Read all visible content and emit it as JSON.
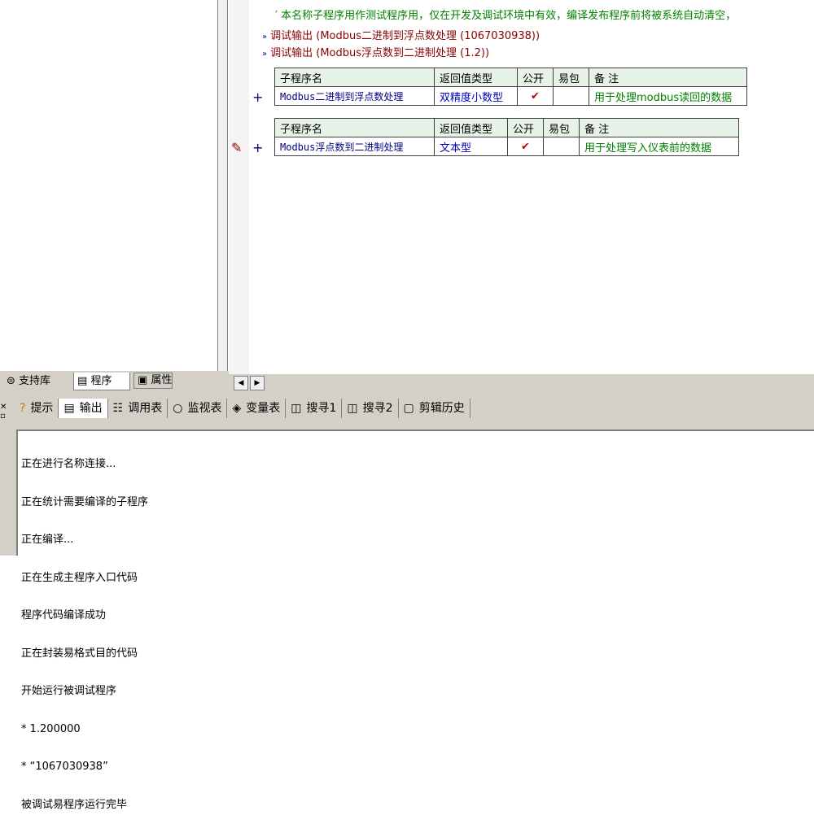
{
  "code": {
    "comment": "′ 本名称子程序用作测试程序用，仅在开发及调试环境中有效，编译发布程序前将被系统自动清空，",
    "calls": [
      "调试输出 (Modbus二进制到浮点数处理 (1067030938))",
      "调试输出 (Modbus浮点数到二进制处理 (1.2))"
    ]
  },
  "table1": {
    "headers": [
      "子程序名",
      "返回值类型",
      "公开",
      "易包",
      "备 注"
    ],
    "row": {
      "name": "Modbus二进制到浮点数处理",
      "ret": "双精度小数型",
      "public": "✔",
      "easy": "",
      "note": "用于处理modbus读回的数据"
    }
  },
  "table2": {
    "headers": [
      "子程序名",
      "返回值类型",
      "公开",
      "易包",
      "备 注"
    ],
    "row": {
      "name": "Modbus浮点数到二进制处理",
      "ret": "文本型",
      "public": "✔",
      "easy": "",
      "note": "用于处理写入仪表前的数据"
    }
  },
  "left_tabs": [
    "支持库",
    "程序",
    "属性"
  ],
  "output_tabs": [
    "提示",
    "输出",
    "调用表",
    "监视表",
    "变量表",
    "搜寻1",
    "搜寻2",
    "剪辑历史"
  ],
  "output_lines": [
    "正在进行名称连接...",
    "正在统计需要编译的子程序",
    "正在编译...",
    "正在生成主程序入口代码",
    "程序代码编译成功",
    "正在封装易格式目的代码",
    "开始运行被调试程序",
    "* 1.200000",
    "* “1067030938”",
    "被调试易程序运行完毕"
  ],
  "colors": {
    "comment": "#008000",
    "call": "#8b0000",
    "accent_header": "#e8f3e8"
  }
}
